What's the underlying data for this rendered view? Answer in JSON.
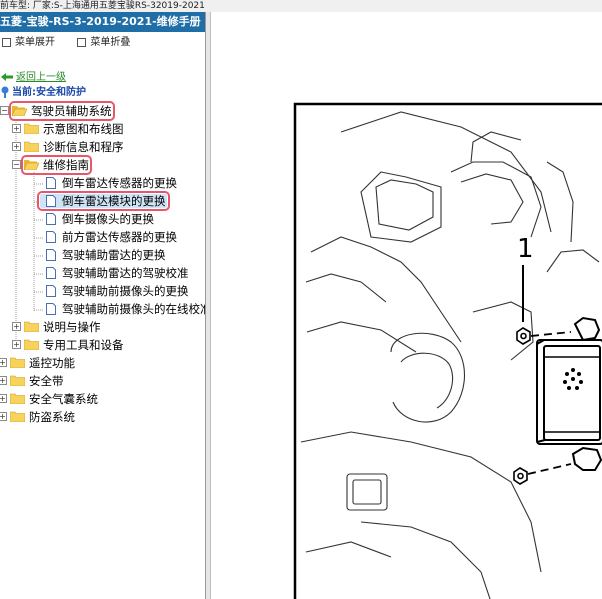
{
  "top_info": "前车型:  厂家:S-上海通用五菱宝骏RS-32019-2021",
  "panel_title": "五菱-宝骏-RS-3-2019-2021-维修手册",
  "toolbar": {
    "expand_label": "菜单展开",
    "collapse_label": "菜单折叠"
  },
  "back_label": "返回上一级",
  "current_label": "当前:安全和防护",
  "tree": {
    "root": "驾驶员辅助系统",
    "schematics": "示意图和布线图",
    "diagnostics": "诊断信息和程序",
    "repair": "维修指南",
    "docs": [
      "倒车雷达传感器的更换",
      "倒车雷达模块的更换",
      "倒车摄像头的更换",
      "前方雷达传感器的更换",
      "驾驶辅助雷达的更换",
      "驾驶辅助雷达的驾驶校准",
      "驾驶辅助前摄像头的更换",
      "驾驶辅助前摄像头的在线校准"
    ],
    "description": "说明与操作",
    "tools": "专用工具和设备",
    "remote": "遥控功能",
    "belts": "安全带",
    "airbag": "安全气囊系统",
    "theft": "防盗系统"
  },
  "diagram": {
    "callout": "1"
  }
}
